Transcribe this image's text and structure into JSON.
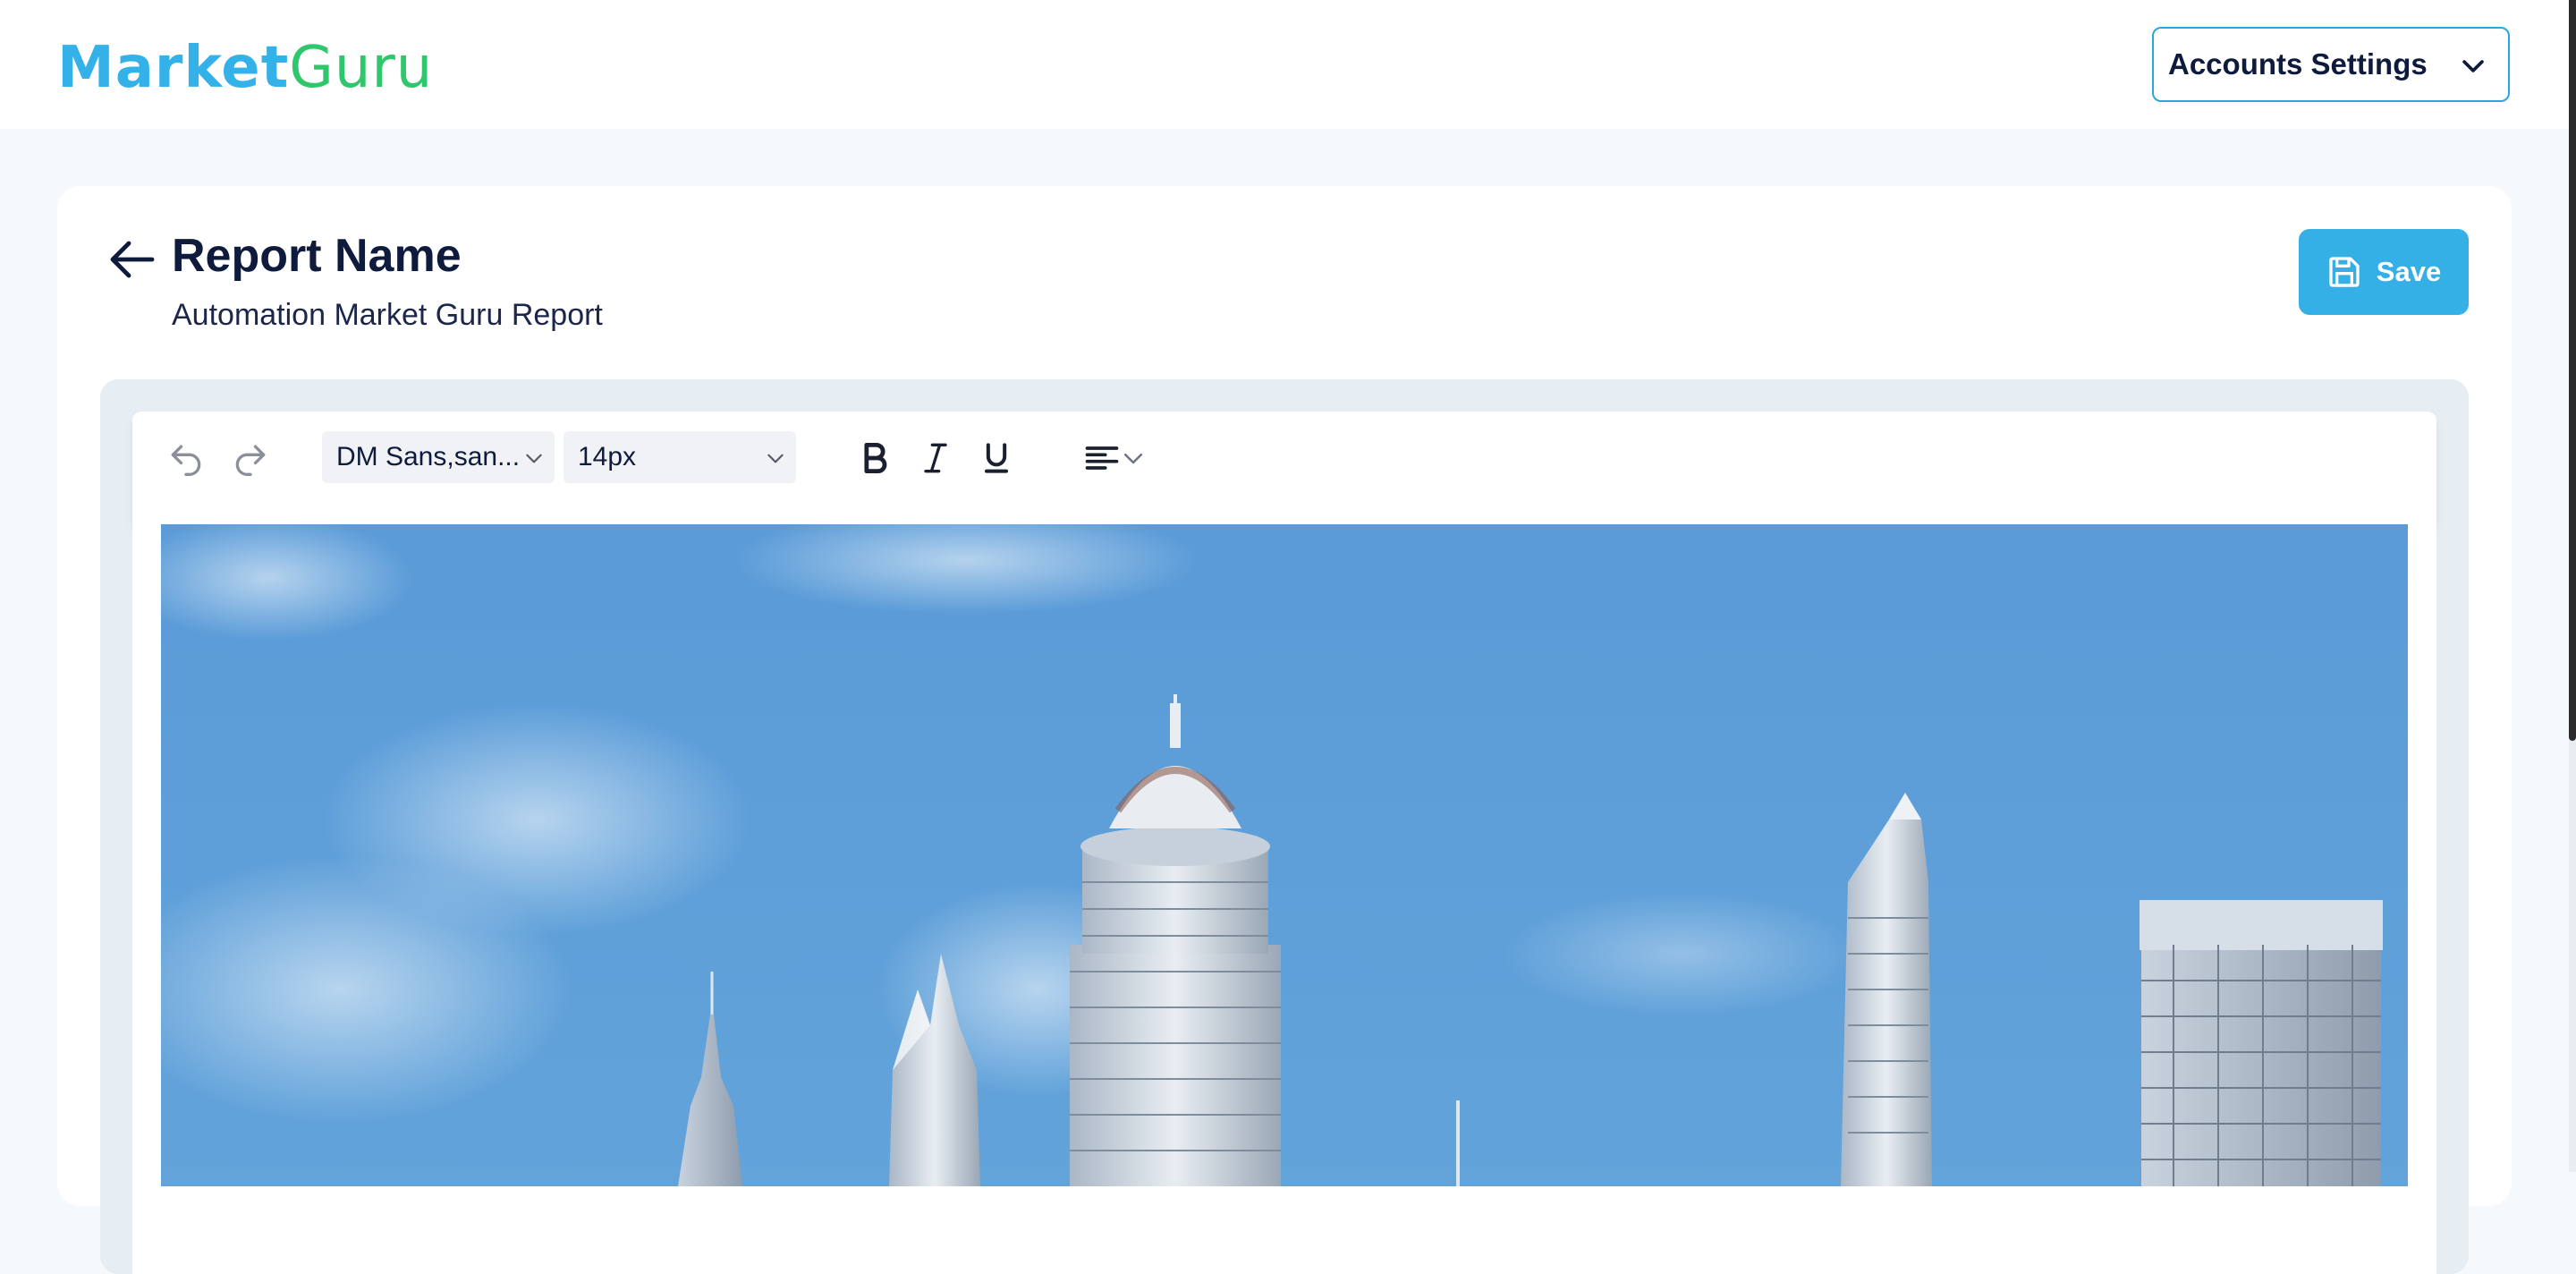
{
  "app": {
    "logo_part1": "Market",
    "logo_part2": "Guru",
    "brand_blue": "#34b1e8",
    "brand_green": "#2ec76b"
  },
  "header": {
    "account_menu_label": "Accounts Settings",
    "account_menu_icon": "chevron-down-icon"
  },
  "page": {
    "back_icon": "arrow-left-icon",
    "title": "Report Name",
    "subtitle": "Automation Market Guru Report",
    "save_label": "Save",
    "save_icon": "floppy-disk-icon"
  },
  "editor": {
    "toolbar": {
      "undo_icon": "undo-icon",
      "redo_icon": "redo-icon",
      "font_family": "DM Sans,san...",
      "font_size": "14px",
      "bold_icon": "bold-icon",
      "italic_icon": "italic-icon",
      "underline_icon": "underline-icon",
      "align_icon": "align-left-icon"
    },
    "content_image": "city-skyline-image"
  },
  "colors": {
    "accent": "#35b0e6",
    "page_bg": "#f6f9fc",
    "text_dark": "#0f1b3d",
    "sky": "#5fa0d6"
  }
}
